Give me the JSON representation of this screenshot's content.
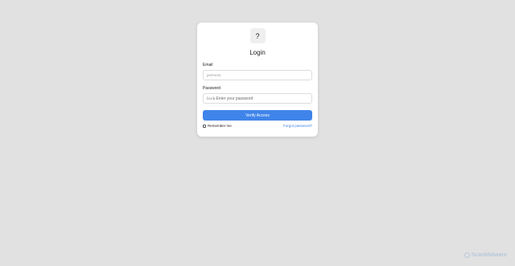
{
  "login": {
    "logo_glyph": "?",
    "title": "Login",
    "email_label": "Email",
    "email_prefix": "person",
    "email_placeholder": "",
    "password_label": "Password",
    "password_prefix": "lock",
    "password_placeholder": "Enter your password",
    "submit_label": "Verify Access",
    "remember_label": "Remember me",
    "forgot_label": "Forgot password?"
  },
  "watermark": {
    "text": "ScanMalware"
  },
  "colors": {
    "background": "#e1e1e1",
    "accent": "#3f84ea",
    "card": "#ffffff"
  }
}
